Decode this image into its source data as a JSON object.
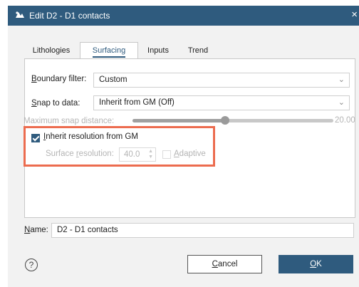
{
  "window": {
    "title": "Edit D2 - D1 contacts",
    "close_glyph": "×"
  },
  "tabs": [
    {
      "label": "Lithologies",
      "active": false
    },
    {
      "label": "Surfacing",
      "active": true
    },
    {
      "label": "Inputs",
      "active": false
    },
    {
      "label": "Trend",
      "active": false
    }
  ],
  "surfacing": {
    "boundary_filter": {
      "label_first": "B",
      "label_rest": "oundary filter:",
      "value": "Custom"
    },
    "snap_to_data": {
      "label_first": "S",
      "label_rest": "nap to data:",
      "value": "Inherit from GM (Off)"
    },
    "max_snap_distance": {
      "label": "Maximum snap distance:",
      "value_text": "20.00",
      "level_fraction": 0.46
    },
    "inherit_resolution": {
      "label_first": "I",
      "label_rest": "nherit resolution from GM",
      "checked": true
    },
    "surface_resolution": {
      "label_pre": "Surface ",
      "label_first": "r",
      "label_rest": "esolution:",
      "value": "40.0"
    },
    "adaptive": {
      "label_first": "A",
      "label_rest": "daptive",
      "checked": false
    }
  },
  "name_field": {
    "label_first": "N",
    "label_rest": "ame:",
    "value": "D2 - D1 contacts"
  },
  "buttons": {
    "help": "?",
    "cancel_first": "C",
    "cancel_rest": "ancel",
    "ok_first": "O",
    "ok_rest": "K"
  },
  "colors": {
    "accent": "#2f5b7e",
    "highlight": "#ec6c4f"
  },
  "icons": {
    "app": "leapfrog-app-icon",
    "chevron": "chevron-down-icon",
    "help": "help-circle-icon"
  }
}
